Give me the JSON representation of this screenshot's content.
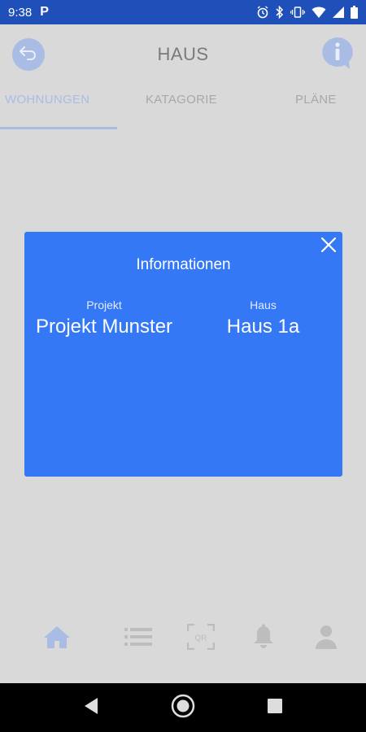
{
  "status_bar": {
    "time": "9:38",
    "p_label": "P"
  },
  "header": {
    "title": "HAUS"
  },
  "tabs": [
    {
      "label": "WOHNUNGEN",
      "active": true
    },
    {
      "label": "KATAGORIE",
      "active": false
    },
    {
      "label": "PLÄNE",
      "active": false
    }
  ],
  "modal": {
    "title": "Informationen",
    "project_label": "Projekt",
    "project_value": "Projekt Munster",
    "house_label": "Haus",
    "house_value": "Haus 1a"
  },
  "bottom_nav": {
    "items": [
      "home-icon",
      "list-icon",
      "qr-icon",
      "bell-icon",
      "user-icon"
    ],
    "qr_text": "QR"
  },
  "colors": {
    "accent": "#3478f6",
    "status_bar": "#1f4fb8",
    "dimmed_accent": "#a9bde4",
    "overlay_bg": "#d9d9d9"
  }
}
